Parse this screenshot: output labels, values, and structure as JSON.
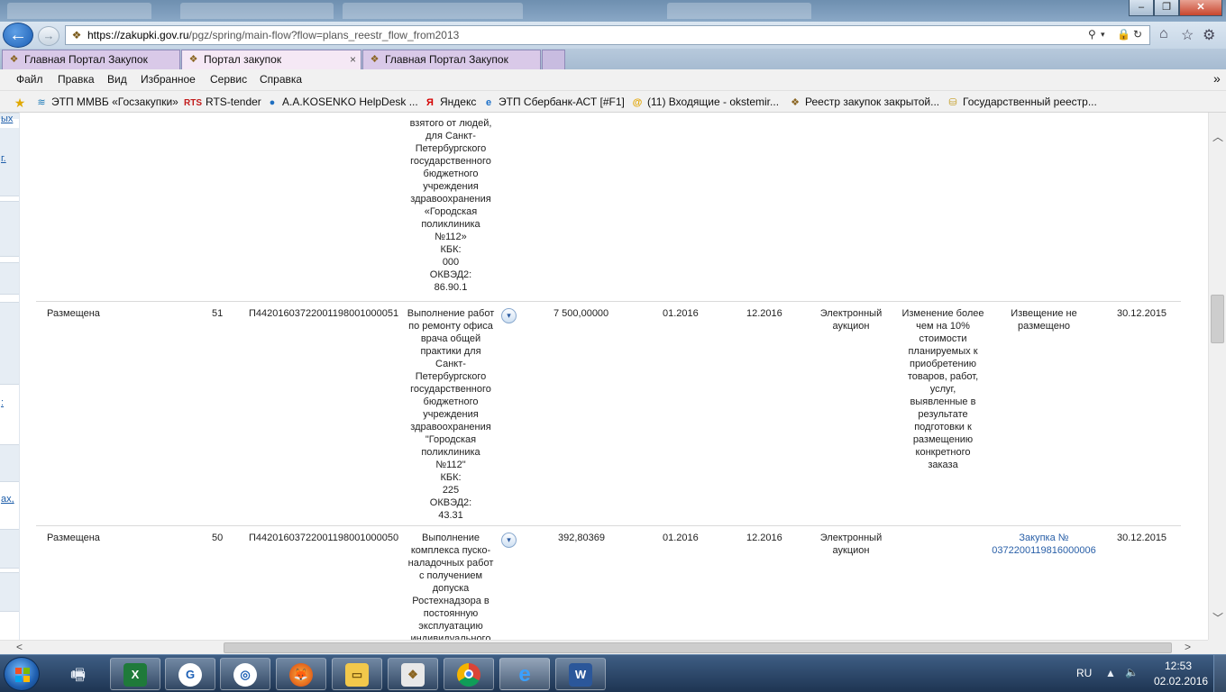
{
  "browser": {
    "address": {
      "host": "https://zakupki.gov.ru",
      "path": "/pgz/spring/main-flow?flow=plans_reestr_flow_from2013",
      "search_icon": "search-icon",
      "lock_icon": "lock-icon",
      "refresh_icon": "refresh-icon"
    },
    "tabs": [
      {
        "label": "Главная Портал Закупок",
        "active": false
      },
      {
        "label": "Портал закупок",
        "active": true,
        "close": "×"
      },
      {
        "label": "Главная Портал Закупок",
        "active": false
      }
    ],
    "menu": [
      "Файл",
      "Правка",
      "Вид",
      "Избранное",
      "Сервис",
      "Справка"
    ],
    "favorites": [
      {
        "label": "ЭТП ММВБ «Госзакупки»",
        "icon": "mmvb-icon"
      },
      {
        "label": "RTS-tender",
        "icon": "rts-icon",
        "icon_text": "RTS"
      },
      {
        "label": "А.А.KOSENKO  HelpDesk ...",
        "icon": "helpdesk-icon"
      },
      {
        "label": "Яндекс",
        "icon": "yandex-icon",
        "icon_text": "Я"
      },
      {
        "label": "ЭТП Сбербанк-АСТ [#F1]",
        "icon": "ie-page-icon"
      },
      {
        "label": "(11) Входящие - okstemir...",
        "icon": "mail-icon"
      },
      {
        "label": "Реестр закупок закрытой...",
        "icon": "eagle-icon"
      },
      {
        "label": "Государственный реестр...",
        "icon": "coins-icon"
      }
    ]
  },
  "left_links": [
    "ых",
    "г.",
    ":",
    "ах,"
  ],
  "table": {
    "row0_fragment": {
      "description": "взятого от людей,\nдля Санкт-\nПетербургского\nгосударственного\nбюджетного\nучреждения\nздравоохранения\n«Городская\nполиклиника\n№112»\nКБК:\n000\nОКВЭД2:\n86.90.1"
    },
    "rows": [
      {
        "status": "Размещена",
        "num": "51",
        "code": "П442016037220011980010000 51",
        "description": "Выполнение работ\nпо ремонту офиса\nврача общей\nпрактики для\nСанкт-\nПетербургского\nгосударственного\nбюджетного\nучреждения\nздравоохранения\n\"Городская\nполиклиника\n№112\"\nКБК:\n225\nОКВЭД2:\n43.31",
        "amount": "7 500,00000",
        "start": "01.2016",
        "end": "12.2016",
        "method": "Электронный\nаукцион",
        "change_reason": "Изменение более\nчем на 10%\nстоимости\nпланируемых к\nприобретению\nтоваров, работ,\nуслуг,\nвыявленные в\nрезультате\nподготовки к\nразмещению\nконкретного\nзаказа",
        "notice": "Извещение не\nразмещено",
        "date": "30.12.2015"
      },
      {
        "status": "Размещена",
        "num": "50",
        "code": "П442016037220011980010000 50",
        "description": "Выполнение\nкомплекса пуско-\nналадочных работ\nс получением\nдопуска\nРостехнадзора в\nпостоянную\nэксплуатацию\nиндивидуального",
        "amount": "392,80369",
        "start": "01.2016",
        "end": "12.2016",
        "method": "Электронный\nаукцион",
        "change_reason": "",
        "notice": "Закупка №\n0372200119816000006",
        "date": "30.12.2015"
      }
    ]
  },
  "taskbar": {
    "lang": "RU",
    "time": "12:53",
    "date": "02.02.2016"
  }
}
